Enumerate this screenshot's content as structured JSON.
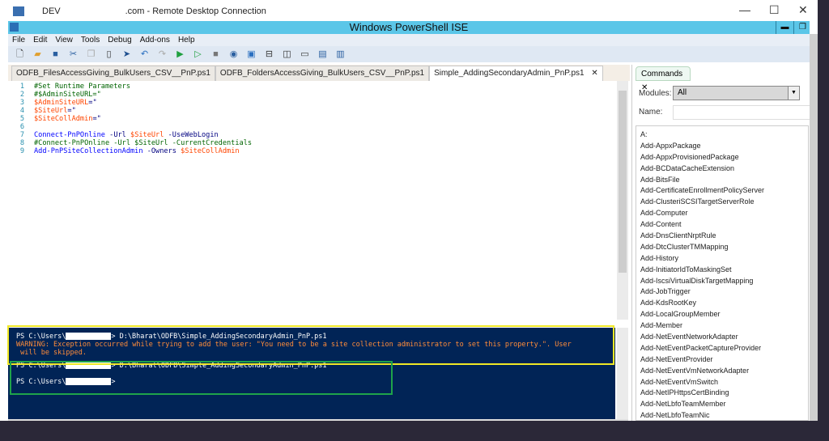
{
  "rdp": {
    "title_left": "DEV",
    "title_right": ".com - Remote Desktop Connection",
    "minimize": "—",
    "maximize": "☐",
    "close": "✕"
  },
  "ise": {
    "title": "Windows PowerShell ISE",
    "min": "▬",
    "restore": "❐"
  },
  "menu": [
    "File",
    "Edit",
    "View",
    "Tools",
    "Debug",
    "Add-ons",
    "Help"
  ],
  "toolbar_icons": [
    "new-icon",
    "open-icon",
    "save-icon",
    "cut-icon",
    "copy-icon",
    "paste-icon",
    "clear-icon",
    "undo-icon",
    "redo-icon",
    "run-icon",
    "run-selection-icon",
    "stop-icon",
    "remote-icon",
    "powershell-icon",
    "layout-top-icon",
    "layout-right-icon",
    "layout-max-icon",
    "show-script-icon",
    "show-commands-icon"
  ],
  "tabs": [
    {
      "label": "ODFB_FilesAccessGiving_BulkUsers_CSV__PnP.ps1"
    },
    {
      "label": "ODFB_FoldersAccessGiving_BulkUsers_CSV__PnP.ps1"
    },
    {
      "label": "Simple_AddingSecondaryAdmin_PnP.ps1",
      "close": "✕"
    }
  ],
  "code": [
    {
      "n": "1",
      "parts": [
        [
          "cm",
          "#Set Runtime Parameters"
        ]
      ]
    },
    {
      "n": "2",
      "parts": [
        [
          "cm",
          "#$AdminSiteURL=\""
        ]
      ]
    },
    {
      "n": "3",
      "parts": [
        [
          "var",
          "$AdminSiteURL"
        ],
        [
          "par",
          "=\""
        ]
      ]
    },
    {
      "n": "4",
      "parts": [
        [
          "var",
          "$SiteUrl"
        ],
        [
          "par",
          "=\""
        ]
      ]
    },
    {
      "n": "5",
      "parts": [
        [
          "var",
          "$SiteCollAdmin"
        ],
        [
          "par",
          "=\""
        ]
      ]
    },
    {
      "n": "6",
      "parts": []
    },
    {
      "n": "7",
      "parts": [
        [
          "cmd",
          "Connect-PnPOnline"
        ],
        [
          "par",
          " -Url "
        ],
        [
          "var",
          "$SiteUrl"
        ],
        [
          "par",
          " -UseWebLogin"
        ]
      ]
    },
    {
      "n": "8",
      "parts": [
        [
          "cm",
          "#Connect-PnPOnline -Url $SiteUrl -CurrentCredentials"
        ]
      ]
    },
    {
      "n": "9",
      "parts": [
        [
          "cmd",
          "Add-PnPSiteCollectionAdmin"
        ],
        [
          "par",
          " -Owners "
        ],
        [
          "var",
          "$SiteCollAdmin"
        ]
      ]
    }
  ],
  "console": {
    "prompt": "PS C:\\Users\\",
    "cmd1": "> D:\\Bharat\\ODFB\\Simple_AddingSecondaryAdmin_PnP.ps1",
    "warn1": "WARNING: Exception occurred while trying to add the user: \"You need to be a site collection administrator to set this property.\". User",
    "warn2": " will be skipped.",
    "cmd2": "> D:\\Bharat\\ODFB\\Simple_AddingSecondaryAdmin_PnP.ps1",
    "end": ">"
  },
  "commands": {
    "tab": "Commands",
    "close": "✕",
    "modules_label": "Modules:",
    "modules_value": "All",
    "name_label": "Name:",
    "name_value": "",
    "items": [
      "A:",
      "Add-AppxPackage",
      "Add-AppxProvisionedPackage",
      "Add-BCDataCacheExtension",
      "Add-BitsFile",
      "Add-CertificateEnrollmentPolicyServer",
      "Add-ClusteriSCSITargetServerRole",
      "Add-Computer",
      "Add-Content",
      "Add-DnsClientNrptRule",
      "Add-DtcClusterTMMapping",
      "Add-History",
      "Add-InitiatorIdToMaskingSet",
      "Add-IscsiVirtualDiskTargetMapping",
      "Add-JobTrigger",
      "Add-KdsRootKey",
      "Add-LocalGroupMember",
      "Add-Member",
      "Add-NetEventNetworkAdapter",
      "Add-NetEventPacketCaptureProvider",
      "Add-NetEventProvider",
      "Add-NetEventVmNetworkAdapter",
      "Add-NetEventVmSwitch",
      "Add-NetIPHttpsCertBinding",
      "Add-NetLbfoTeamMember",
      "Add-NetLbfoTeamNic"
    ]
  }
}
